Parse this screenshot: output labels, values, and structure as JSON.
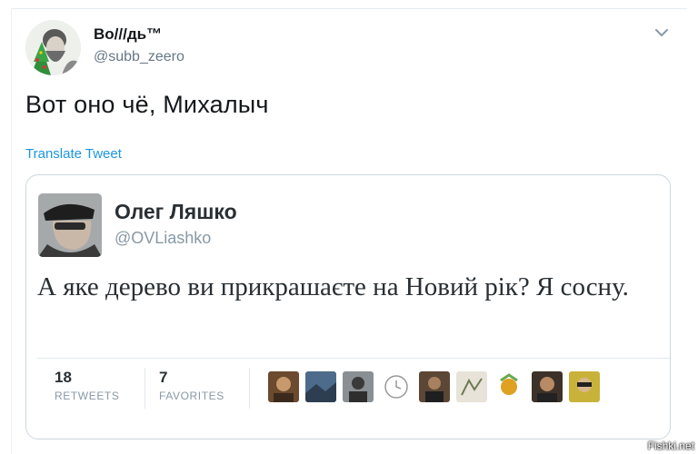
{
  "tweet": {
    "display_name": "Во///дь™",
    "handle": "@subb_zeero",
    "text": "Вот оно чё, Михалыч",
    "translate_label": "Translate Tweet",
    "avatar_icon": "bearded-man-avatar-icon",
    "menu_icon": "chevron-down-icon"
  },
  "quoted_tweet": {
    "display_name": "Олег Ляшко",
    "handle": "@OVLiashko",
    "text": "А яке дерево ви прикрашаєте на Новий рік? Я сосну.",
    "retweets": {
      "count": "18",
      "label": "RETWEETS"
    },
    "favorites": {
      "count": "7",
      "label": "FAVORITES"
    },
    "favoriter_avatars": [
      "avatar-1",
      "avatar-2",
      "avatar-3",
      "avatar-4",
      "avatar-5",
      "avatar-6",
      "avatar-7",
      "avatar-8",
      "avatar-9"
    ]
  },
  "watermark": "Fishki.net",
  "colors": {
    "link": "#1b95e0",
    "text": "#14171a",
    "muted": "#657786",
    "border": "#ccd6dd"
  }
}
